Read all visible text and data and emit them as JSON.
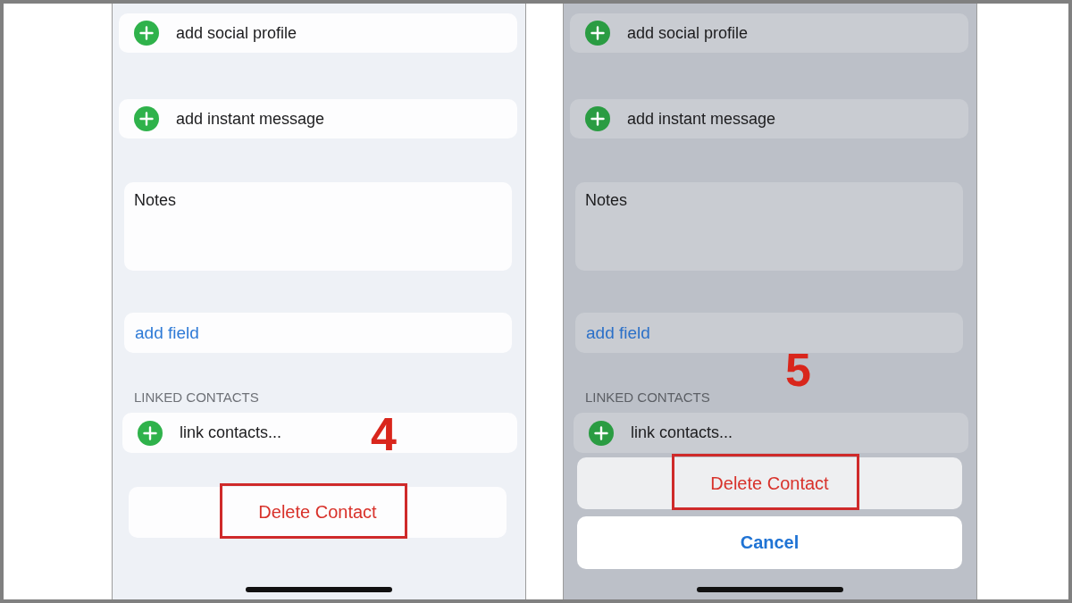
{
  "panels": [
    {
      "step": "4",
      "dimmed": false,
      "add_rows": [
        {
          "label": "add social profile"
        },
        {
          "label": "add instant message"
        }
      ],
      "notes": {
        "label": "Notes"
      },
      "add_field": "add field",
      "linked_contacts": {
        "header": "LINKED CONTACTS",
        "rows": [
          {
            "label": "link contacts..."
          }
        ]
      },
      "buttons": [
        {
          "kind": "list",
          "label": "Delete Contact",
          "highlighted": true
        }
      ]
    },
    {
      "step": "5",
      "dimmed": true,
      "add_rows": [
        {
          "label": "add social profile"
        },
        {
          "label": "add instant message"
        }
      ],
      "notes": {
        "label": "Notes"
      },
      "add_field": "add field",
      "linked_contacts": {
        "header": "LINKED CONTACTS",
        "rows": [
          {
            "label": "link contacts..."
          }
        ]
      },
      "buttons": [
        {
          "kind": "sheet_destructive",
          "label": "Delete Contact",
          "highlighted": true
        },
        {
          "kind": "sheet_cancel",
          "label": "Cancel",
          "highlighted": false
        }
      ]
    }
  ]
}
